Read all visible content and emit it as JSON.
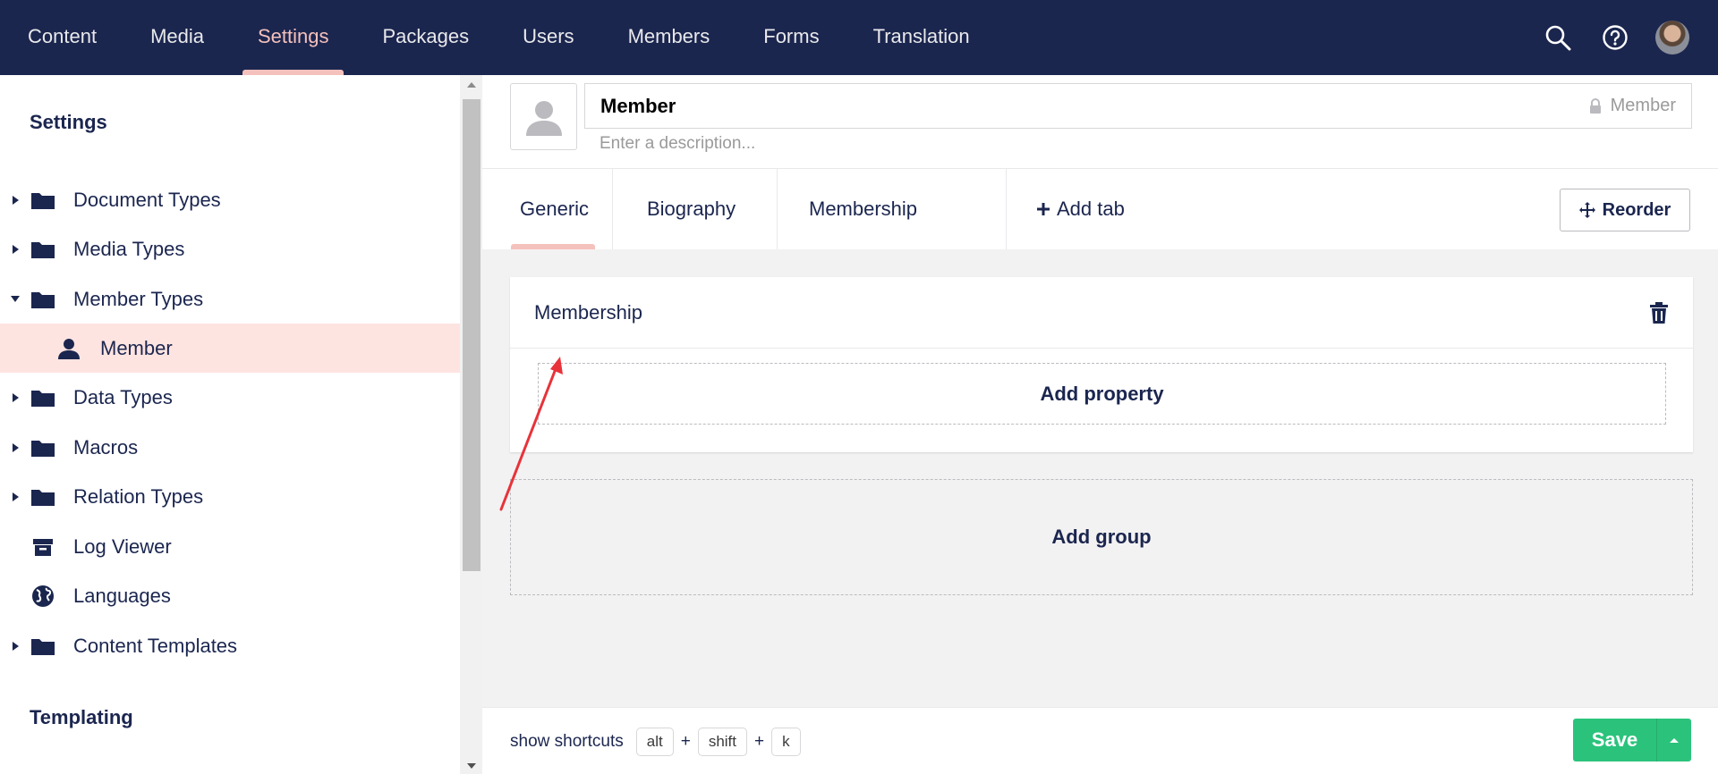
{
  "topnav": {
    "items": [
      {
        "label": "Content"
      },
      {
        "label": "Media"
      },
      {
        "label": "Settings",
        "active": true
      },
      {
        "label": "Packages"
      },
      {
        "label": "Users"
      },
      {
        "label": "Members"
      },
      {
        "label": "Forms"
      },
      {
        "label": "Translation"
      }
    ],
    "icons": [
      "search-icon",
      "help-icon",
      "user-avatar"
    ],
    "active_color": "#f5c1bc",
    "background": "#1b264f"
  },
  "sidebar": {
    "section_settings": "Settings",
    "items": [
      {
        "label": "Document Types",
        "icon": "folder-icon",
        "expanded": false
      },
      {
        "label": "Media Types",
        "icon": "folder-icon",
        "expanded": false
      },
      {
        "label": "Member Types",
        "icon": "folder-icon",
        "expanded": true
      },
      {
        "label": "Member",
        "icon": "user-icon",
        "selected": true
      },
      {
        "label": "Data Types",
        "icon": "folder-icon",
        "expanded": false
      },
      {
        "label": "Macros",
        "icon": "folder-icon",
        "expanded": false
      },
      {
        "label": "Relation Types",
        "icon": "folder-icon",
        "expanded": false
      },
      {
        "label": "Log Viewer",
        "icon": "archive-icon"
      },
      {
        "label": "Languages",
        "icon": "globe-icon"
      },
      {
        "label": "Content Templates",
        "icon": "folder-icon",
        "expanded": false
      }
    ],
    "section_templating": "Templating",
    "selected_color": "#fee4e1"
  },
  "editor": {
    "name": "Member",
    "alias": "Member",
    "description_placeholder": "Enter a description...",
    "tabs": [
      {
        "label": "Generic",
        "active": true
      },
      {
        "label": "Biography"
      },
      {
        "label": "Membership"
      }
    ],
    "add_tab_label": "Add tab",
    "reorder_label": "Reorder",
    "group": {
      "name": "Membership",
      "add_property_label": "Add property"
    },
    "add_group_label": "Add group"
  },
  "footer": {
    "shortcuts_label": "show shortcuts",
    "keys": [
      "alt",
      "shift",
      "k"
    ],
    "plus": "+",
    "save_label": "Save",
    "save_color": "#2bc37c"
  }
}
